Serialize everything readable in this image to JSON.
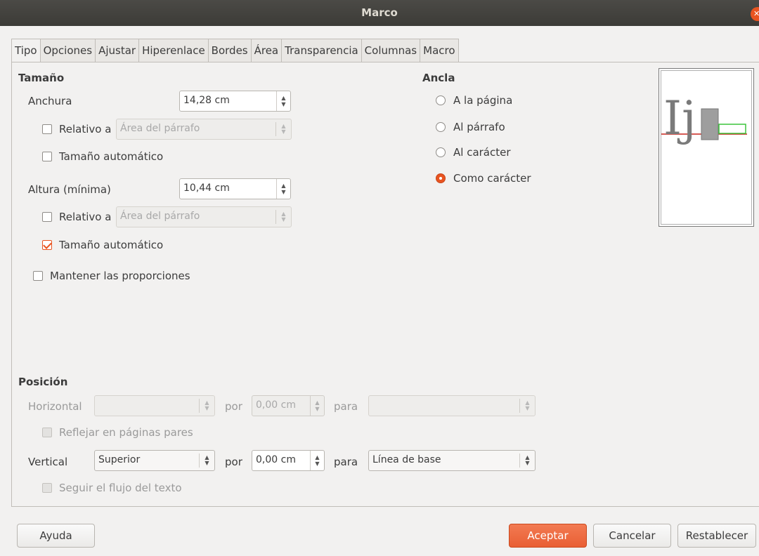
{
  "window": {
    "title": "Marco",
    "close_glyph": "✕"
  },
  "tabs": [
    "Tipo",
    "Opciones",
    "Ajustar",
    "Hiperenlace",
    "Bordes",
    "Área",
    "Transparencia",
    "Columnas",
    "Macro"
  ],
  "size": {
    "section": "Tamaño",
    "width_label": "Anchura",
    "width_value": "14,28 cm",
    "relative_label": "Relativo a",
    "relative_value": "Área del párrafo",
    "auto_label": "Tamaño automático",
    "height_label": "Altura (mínima)",
    "height_value": "10,44 cm",
    "height_relative_label": "Relativo a",
    "height_relative_value": "Área del párrafo",
    "height_auto_label": "Tamaño automático",
    "keep_ratio_label": "Mantener las proporciones"
  },
  "anchor": {
    "section": "Ancla",
    "options": [
      "A la página",
      "Al párrafo",
      "Al carácter",
      "Como carácter"
    ],
    "selected": "Como carácter"
  },
  "preview": {
    "glyphs": "Ij"
  },
  "position": {
    "section": "Posición",
    "horizontal_label": "Horizontal",
    "horizontal_value": "",
    "by_label": "por",
    "horizontal_by_value": "0,00 cm",
    "to_label": "para",
    "horizontal_to_value": "",
    "mirror_label": "Reflejar en páginas pares",
    "vertical_label": "Vertical",
    "vertical_value": "Superior",
    "vertical_by_label": "por",
    "vertical_by_value": "0,00 cm",
    "vertical_to_label": "para",
    "vertical_to_value": "Línea de base",
    "follow_label": "Seguir el flujo del texto"
  },
  "buttons": {
    "help": "Ayuda",
    "ok": "Aceptar",
    "cancel": "Cancelar",
    "reset": "Restablecer"
  },
  "colors": {
    "accent": "#e95420",
    "titlebar": "#3c3b37",
    "background": "#f2f1f0"
  }
}
